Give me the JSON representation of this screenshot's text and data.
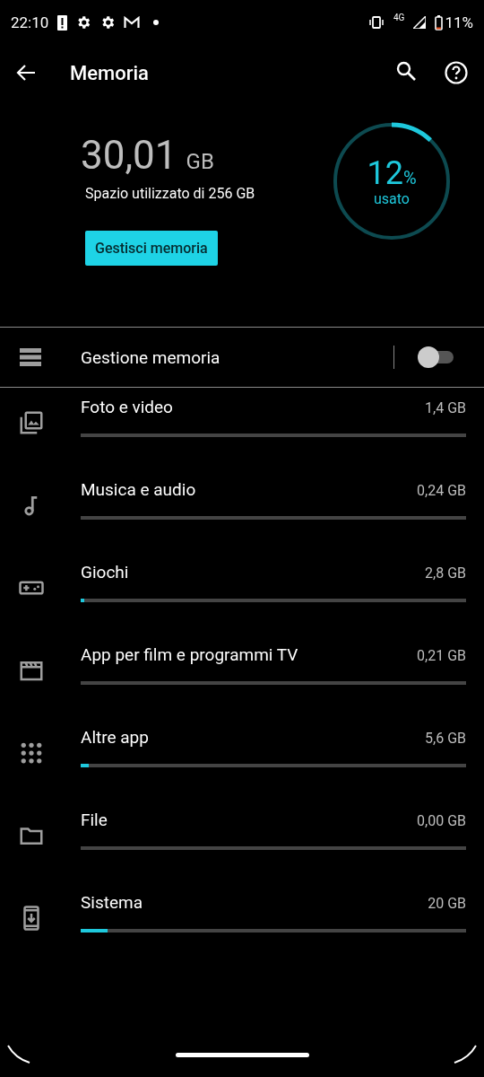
{
  "status_bar": {
    "time": "22:10",
    "network": "4G",
    "battery": "11%"
  },
  "toolbar": {
    "title": "Memoria"
  },
  "summary": {
    "used": "30,01",
    "unit": "GB",
    "caption": "Spazio utilizzato di 256 GB",
    "button": "Gestisci memoria",
    "ring": {
      "percent": "12",
      "percent_sign": "%",
      "label": "usato"
    }
  },
  "storage_manager": {
    "label": "Gestione memoria",
    "on": false
  },
  "categories": [
    {
      "kind": "photos",
      "name": "Foto e video",
      "size": "1,4 GB"
    },
    {
      "kind": "music",
      "name": "Musica e audio",
      "size": "0,24 GB"
    },
    {
      "kind": "games",
      "name": "Giochi",
      "size": "2,8 GB",
      "level": 0.01
    },
    {
      "kind": "movies",
      "name": "App per film e programmi TV",
      "size": "0,21 GB"
    },
    {
      "kind": "apps",
      "name": "Altre app",
      "size": "5,6 GB",
      "level": 0.02
    },
    {
      "kind": "files",
      "name": "File",
      "size": "0,00 GB"
    },
    {
      "kind": "system",
      "name": "Sistema",
      "size": "20 GB",
      "level": 0.07
    }
  ]
}
